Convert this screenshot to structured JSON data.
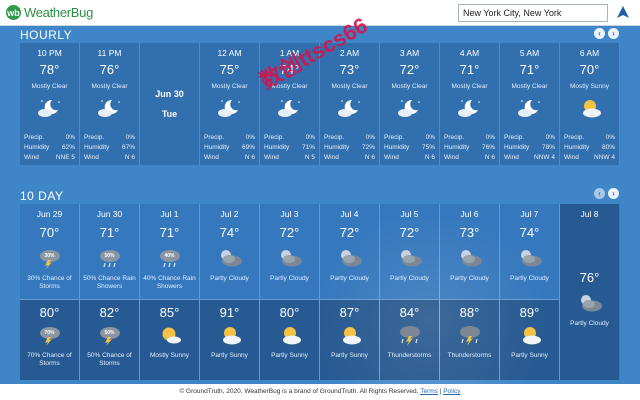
{
  "header": {
    "logo_mark": "wb",
    "logo_text": "WeatherBug",
    "search_value": "New York City, New York"
  },
  "hourly": {
    "title": "HOURLY",
    "daybreak": {
      "date": "Jun 30",
      "day": "Tue"
    },
    "labels": {
      "precip": "Precip.",
      "humidity": "Humidity",
      "wind": "Wind"
    },
    "hours": [
      {
        "time": "10 PM",
        "temp": "78°",
        "cond": "Mostly Clear",
        "precip": "0%",
        "humidity": "62%",
        "wind": "NNE 5",
        "icon": "moon-cloud-icon"
      },
      {
        "time": "11 PM",
        "temp": "76°",
        "cond": "Mostly Clear",
        "precip": "0%",
        "humidity": "67%",
        "wind": "N 6",
        "icon": "moon-cloud-icon"
      },
      {
        "time": "12 AM",
        "temp": "75°",
        "cond": "Mostly Clear",
        "precip": "0%",
        "humidity": "69%",
        "wind": "N 6",
        "icon": "moon-cloud-icon"
      },
      {
        "time": "1 AM",
        "temp": "74°",
        "cond": "Mostly Clear",
        "precip": "0%",
        "humidity": "71%",
        "wind": "N 5",
        "icon": "moon-cloud-icon"
      },
      {
        "time": "2 AM",
        "temp": "73°",
        "cond": "Mostly Clear",
        "precip": "0%",
        "humidity": "72%",
        "wind": "N 6",
        "icon": "moon-cloud-icon"
      },
      {
        "time": "3 AM",
        "temp": "72°",
        "cond": "Mostly Clear",
        "precip": "0%",
        "humidity": "75%",
        "wind": "N 6",
        "icon": "moon-cloud-icon"
      },
      {
        "time": "4 AM",
        "temp": "71°",
        "cond": "Mostly Clear",
        "precip": "0%",
        "humidity": "76%",
        "wind": "N 6",
        "icon": "moon-cloud-icon"
      },
      {
        "time": "5 AM",
        "temp": "71°",
        "cond": "Mostly Clear",
        "precip": "0%",
        "humidity": "78%",
        "wind": "NNW 4",
        "icon": "moon-cloud-icon"
      },
      {
        "time": "6 AM",
        "temp": "70°",
        "cond": "Mostly Sunny",
        "precip": "0%",
        "humidity": "80%",
        "wind": "NNW 4",
        "icon": "sun-cloud-icon"
      }
    ]
  },
  "tenday": {
    "title": "10 DAY",
    "days": [
      {
        "date": "Jun 29",
        "hi": "70°",
        "cond": "30% Chance of Storms",
        "badge": "30%",
        "lo": "80°",
        "lo_cond": "70% Chance of Storms",
        "lo_badge": "70%"
      },
      {
        "date": "Jun 30",
        "hi": "71°",
        "cond": "50% Chance Rain Showers",
        "badge": "50%",
        "lo": "82°",
        "lo_cond": "50% Chance of Storms",
        "lo_badge": "50%"
      },
      {
        "date": "Jul 1",
        "hi": "71°",
        "cond": "40% Chance Rain Showers",
        "badge": "40%",
        "lo": "85°",
        "lo_cond": "Mostly Sunny",
        "lo_badge": ""
      },
      {
        "date": "Jul 2",
        "hi": "74°",
        "cond": "Partly Cloudy",
        "badge": "",
        "lo": "91°",
        "lo_cond": "Partly Sunny",
        "lo_badge": ""
      },
      {
        "date": "Jul 3",
        "hi": "72°",
        "cond": "Partly Cloudy",
        "badge": "",
        "lo": "80°",
        "lo_cond": "Partly Sunny",
        "lo_badge": ""
      },
      {
        "date": "Jul 4",
        "hi": "72°",
        "cond": "Partly Cloudy",
        "badge": "",
        "lo": "87°",
        "lo_cond": "Partly Sunny",
        "lo_badge": ""
      },
      {
        "date": "Jul 5",
        "hi": "72°",
        "cond": "Partly Cloudy",
        "badge": "",
        "lo": "84°",
        "lo_cond": "Thunderstorms",
        "lo_badge": ""
      },
      {
        "date": "Jul 6",
        "hi": "73°",
        "cond": "Partly Cloudy",
        "badge": "",
        "lo": "88°",
        "lo_cond": "Thunderstorms",
        "lo_badge": ""
      },
      {
        "date": "Jul 7",
        "hi": "74°",
        "cond": "Partly Cloudy",
        "badge": "",
        "lo": "89°",
        "lo_cond": "Partly Sunny",
        "lo_badge": ""
      }
    ],
    "last": {
      "date": "Jul 8",
      "temp": "76°",
      "cond": "Partly Cloudy"
    }
  },
  "footer": {
    "text": "© GroundTruth, 2020. WeatherBug is a brand of GroundTruth. All Rights Reserved.",
    "terms": "Terms",
    "sep": "|",
    "policy": "Policy"
  },
  "overlay_text": "数创ttscs66"
}
